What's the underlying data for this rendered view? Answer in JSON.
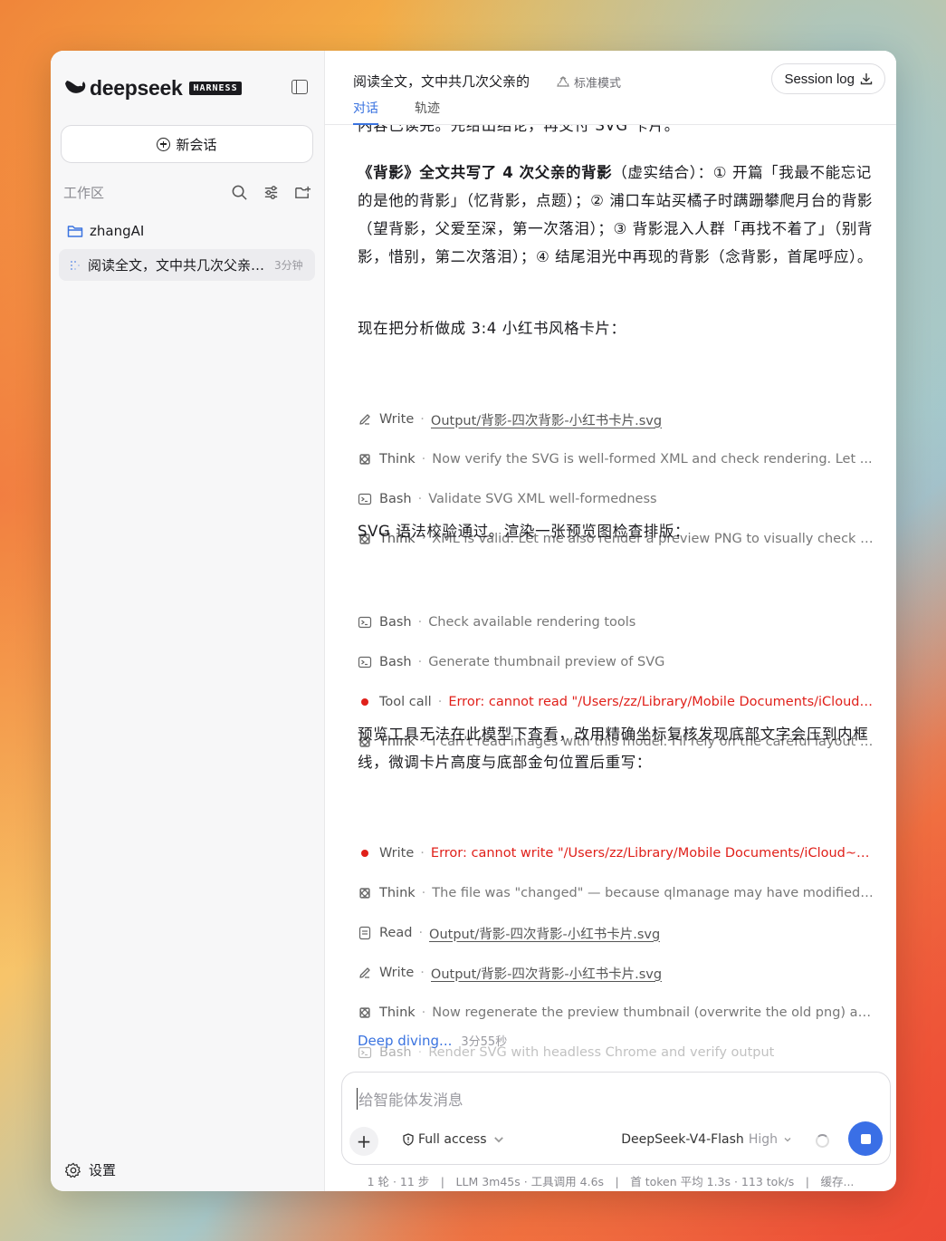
{
  "app": {
    "logo_text": "deepseek",
    "badge": "HARNESS"
  },
  "sidebar": {
    "new_chat": "新会话",
    "workspace_label": "工作区",
    "folder": "zhangAI",
    "chat_item": {
      "title": "阅读全文，文中共几次父亲的背影",
      "time": "3分钟"
    },
    "settings": "设置"
  },
  "header": {
    "title": "阅读全文，文中共几次父亲的",
    "mode": "标准模式",
    "session_log": "Session log",
    "tabs": [
      "对话",
      "轨迹"
    ]
  },
  "conversation": {
    "partial_line": "内容已读完。先给出结论，再交付 SVG 卡片。",
    "summary_bold": "《背影》全文共写了 4 次父亲的背影",
    "summary_rest": "（虚实结合）：① 开篇「我最不能忘记的是他的背影」（忆背影，点题）；② 浦口车站买橘子时蹒跚攀爬月台的背影（望背影，父爱至深，第一次落泪）；③ 背影混入人群「再找不着了」（别背影，惜别，第二次落泪）；④ 结尾泪光中再现的背影（念背影，首尾呼应）。",
    "para2": "现在把分析做成 3:4 小红书风格卡片：",
    "para3": "SVG 语法校验通过。渲染一张预览图检查排版：",
    "para4": "预览工具无法在此模型下查看，改用精确坐标复核发现底部文字会压到内框线，微调卡片高度与底部金句位置后重写：",
    "tools_a": [
      {
        "icon": "pencil-icon",
        "name": "Write",
        "detail": "Output/背影-四次背影-小红书卡片.svg",
        "kind": "link"
      },
      {
        "icon": "atom-icon",
        "name": "Think",
        "detail": "Now verify the SVG is well-formed XML and check rendering. Let ...",
        "kind": "text"
      },
      {
        "icon": "terminal-icon",
        "name": "Bash",
        "detail": "Validate SVG XML well-formedness",
        "kind": "text"
      },
      {
        "icon": "atom-icon",
        "name": "Think",
        "detail": "XML is valid. Let me also render a preview PNG to visually check th...",
        "kind": "text"
      }
    ],
    "tools_b": [
      {
        "icon": "terminal-icon",
        "name": "Bash",
        "detail": "Check available rendering tools",
        "kind": "text"
      },
      {
        "icon": "terminal-icon",
        "name": "Bash",
        "detail": "Generate thumbnail preview of SVG",
        "kind": "text"
      },
      {
        "icon": "error-dot",
        "name": "Tool call",
        "detail": "Error: cannot read \"/Users/zz/Library/Mobile Documents/iCloud~...",
        "kind": "error"
      },
      {
        "icon": "atom-icon",
        "name": "Think",
        "detail": "I can't read images with this model. I'll rely on the careful layout ma...",
        "kind": "text"
      }
    ],
    "tools_c": [
      {
        "icon": "error-dot",
        "name": "Write",
        "detail": "Error: cannot write \"/Users/zz/Library/Mobile Documents/iCloud~m...",
        "kind": "error"
      },
      {
        "icon": "atom-icon",
        "name": "Think",
        "detail": "The file was \"changed\" — because qlmanage may have modified... ...",
        "kind": "text"
      },
      {
        "icon": "doc-icon",
        "name": "Read",
        "detail": "Output/背影-四次背影-小红书卡片.svg",
        "kind": "link"
      },
      {
        "icon": "pencil-icon",
        "name": "Write",
        "detail": "Output/背影-四次背影-小红书卡片.svg",
        "kind": "link"
      },
      {
        "icon": "atom-icon",
        "name": "Think",
        "detail": "Now regenerate the preview thumbnail (overwrite the old png) and ...",
        "kind": "text"
      },
      {
        "icon": "terminal-icon",
        "name": "Bash",
        "detail": "Render SVG with headless Chrome and verify output",
        "kind": "text",
        "faded": true
      }
    ],
    "diving": "Deep diving...",
    "diving_time": "3分55秒"
  },
  "composer": {
    "placeholder": "给智能体发消息",
    "access": "Full access",
    "model": "DeepSeek-V4-Flash",
    "level": "High"
  },
  "status_bar": "1 轮 · 11 步　|　LLM 3m45s · 工具调用 4.6s　|　首 token 平均 1.3s · 113 tok/s　|　缓存...",
  "colors": {
    "accent": "#3a73e0",
    "error": "#e0201a",
    "stop_button": "#3a6fe6"
  }
}
